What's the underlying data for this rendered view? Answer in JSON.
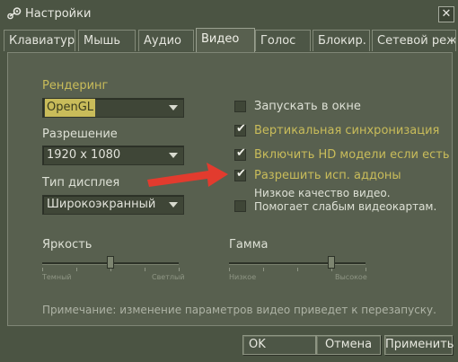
{
  "window": {
    "title": "Настройки",
    "close_label": "✕"
  },
  "tabs": [
    {
      "label": "Клавиатура"
    },
    {
      "label": "Мышь"
    },
    {
      "label": "Аудио"
    },
    {
      "label": "Видео"
    },
    {
      "label": "Голос"
    },
    {
      "label": "Блокир."
    },
    {
      "label": "Сетевой режим"
    }
  ],
  "active_tab": "Видео",
  "video": {
    "rendering_label": "Рендеринг",
    "rendering_value": "OpenGL",
    "resolution_label": "Разрешение",
    "resolution_value": "1920 x 1080",
    "display_type_label": "Тип дисплея",
    "display_type_value": "Широкоэкранный",
    "brightness": {
      "label": "Яркость",
      "min_label": "Темный",
      "max_label": "Светлый",
      "level": 0.5
    },
    "gamma": {
      "label": "Гамма",
      "min_label": "Низкое",
      "max_label": "Высокое",
      "level": 0.75
    },
    "options": [
      {
        "label": "Запускать в окне",
        "checked": false,
        "highlight": false
      },
      {
        "label": "Вертикальная синхронизация",
        "checked": true,
        "highlight": true
      },
      {
        "label": "Включить HD модели если есть",
        "checked": true,
        "highlight": true
      },
      {
        "label": "Разрешить исп. аддоны",
        "checked": true,
        "highlight": true
      },
      {
        "label_line1": "Низкое качество видео.",
        "label_line2": "Помогает слабым видеокартам.",
        "checked": false,
        "highlight": false
      }
    ],
    "note": "Примечание: изменение параметров видео приведет к перезапуску."
  },
  "buttons": {
    "ok": "OK",
    "cancel": "Отмена",
    "apply": "Применить"
  },
  "colors": {
    "background": "#4b5443",
    "panel": "#58604f",
    "accent": "#c9bc5a",
    "annotation_arrow": "#e23b2e"
  },
  "icons": {
    "app": "steam-logo-icon",
    "close": "close-icon",
    "dropdown": "chevron-down-icon",
    "check": "checkmark-icon"
  }
}
